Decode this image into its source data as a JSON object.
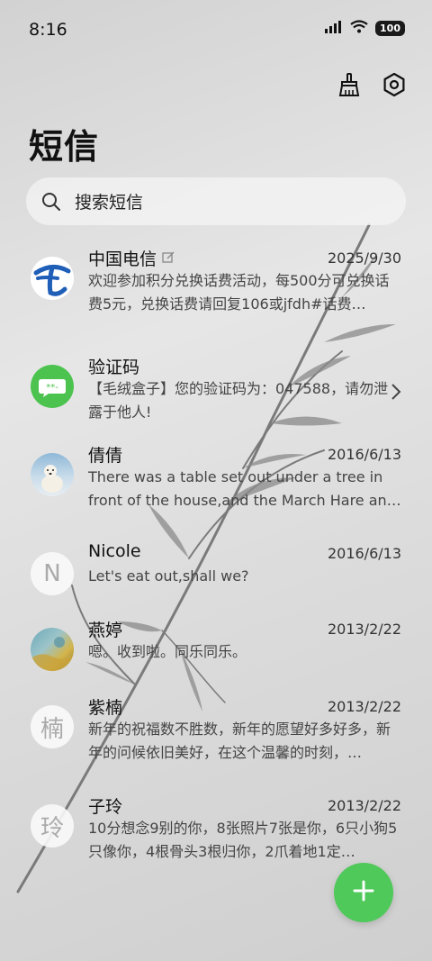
{
  "status": {
    "time": "8:16",
    "battery": "100"
  },
  "header": {
    "title": "短信"
  },
  "search": {
    "placeholder": "搜索短信"
  },
  "conversations": [
    {
      "name": "中国电信",
      "date": "2025/9/30",
      "preview": "欢迎参加积分兑换话费活动，每500分可兑换话费5元，兑换话费请回复106或jfdh#话费…",
      "avatar": "china-telecom-logo",
      "edit_badge": true
    },
    {
      "name": "验证码",
      "date": "",
      "preview": "【毛绒盒子】您的验证码为：047588，请勿泄露于他人!",
      "avatar": "sms-code-icon",
      "chevron": true
    },
    {
      "name": "倩倩",
      "date": "2016/6/13",
      "preview": "There was a table set out under a tree in front of the house,and the March Hare an…",
      "avatar": "polar-bear-photo"
    },
    {
      "name": "Nicole",
      "date": "2016/6/13",
      "preview": "Let's eat out,shall we?",
      "avatar_letter": "N"
    },
    {
      "name": "燕婷",
      "date": "2013/2/22",
      "preview": "嗯。收到啦。同乐同乐。",
      "avatar": "painting-photo"
    },
    {
      "name": "紫楠",
      "date": "2013/2/22",
      "preview": "新年的祝福数不胜数，新年的愿望好多好多，新年的问候依旧美好，在这个温馨的时刻，…",
      "avatar_letter": "楠"
    },
    {
      "name": "子玲",
      "date": "2013/2/22",
      "preview": "10分想念9别的你，8张照片7张是你，6只小狗5只像你，4根骨头3根归你，2爪着地1定…",
      "avatar_letter": "玲"
    }
  ],
  "colors": {
    "accent_green": "#4fc95a",
    "telecom_blue": "#1f5fb8"
  },
  "icons": [
    "signal-icon",
    "wifi-icon",
    "battery-icon",
    "broom-icon",
    "settings-icon",
    "search-icon",
    "edit-icon",
    "chevron-right-icon",
    "plus-icon"
  ]
}
